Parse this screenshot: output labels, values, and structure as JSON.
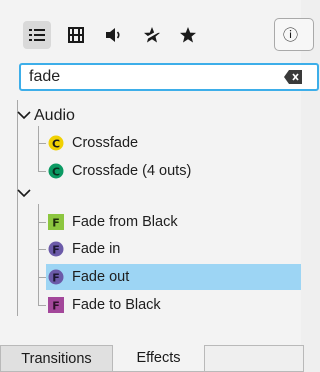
{
  "toolbar": {
    "buttons": [
      {
        "icon": "list-icon",
        "active": true
      },
      {
        "icon": "film-icon",
        "active": false
      },
      {
        "icon": "speaker-icon",
        "active": false
      },
      {
        "icon": "star-slashed-icon",
        "active": false
      },
      {
        "icon": "star-icon",
        "active": false
      }
    ],
    "info_glyph": "ⓘ"
  },
  "search": {
    "value": "fade",
    "clear_icon": "clear-text-icon"
  },
  "tree": {
    "groups": [
      {
        "label": "Audio",
        "expanded": true,
        "items": [
          {
            "label": "Crossfade",
            "badge": "C",
            "badge_color": "#f1d102",
            "badge_text_color": "#1a1a1a",
            "badge_shape": "round",
            "selected": false
          },
          {
            "label": "Crossfade (4 outs)",
            "badge": "C",
            "badge_color": "#0b9a63",
            "badge_text_color": "#0b2e1f",
            "badge_shape": "round",
            "selected": false
          }
        ]
      },
      {
        "label": "",
        "expanded": true,
        "items": [
          {
            "label": "Fade from Black",
            "badge": "F",
            "badge_color": "#8cc63f",
            "badge_text_color": "#1f2d0b",
            "badge_shape": "square",
            "selected": false
          },
          {
            "label": "Fade in",
            "badge": "F",
            "badge_color": "#6b5aa8",
            "badge_text_color": "#1c1733",
            "badge_shape": "round",
            "selected": false
          },
          {
            "label": "Fade out",
            "badge": "F",
            "badge_color": "#6b5aa8",
            "badge_text_color": "#1c1733",
            "badge_shape": "round",
            "selected": true
          },
          {
            "label": "Fade to Black",
            "badge": "F",
            "badge_color": "#a3479a",
            "badge_text_color": "#2e0f2b",
            "badge_shape": "square",
            "selected": false
          }
        ]
      }
    ],
    "selection_color": "#9dd5f4"
  },
  "tabs": [
    {
      "label": "Transitions",
      "active": false
    },
    {
      "label": "Effects",
      "active": true
    }
  ]
}
